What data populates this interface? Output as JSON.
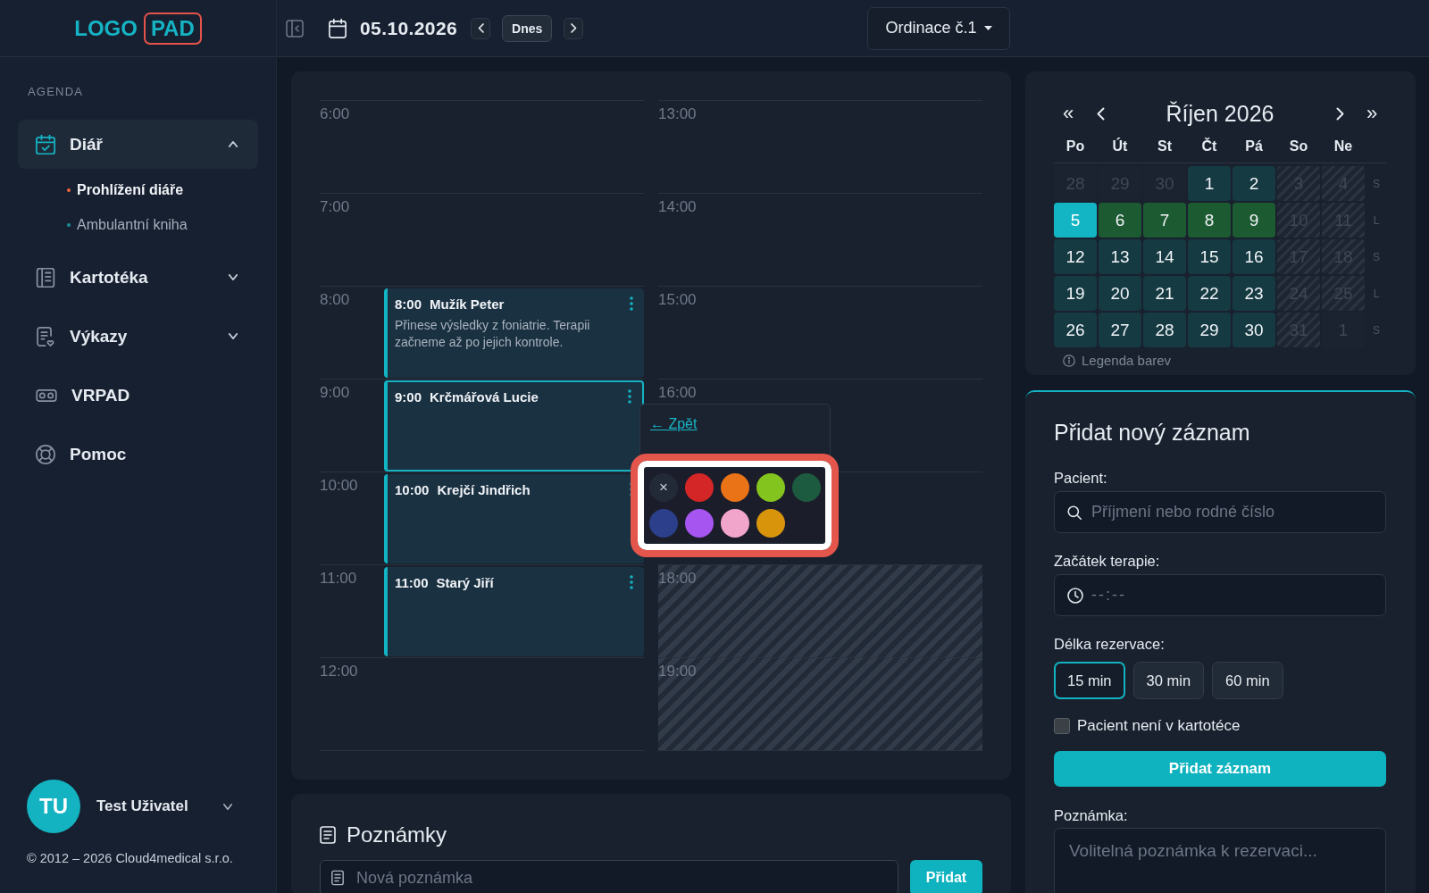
{
  "sidebar": {
    "logo_left": "LOGO",
    "logo_right": "PAD",
    "section": "AGENDA",
    "items": [
      {
        "label": "Diář",
        "kind": "group",
        "expanded": true,
        "selected": true,
        "children": [
          {
            "label": "Prohlížení diáře",
            "selected": true
          },
          {
            "label": "Ambulantní kniha",
            "selected": false
          }
        ]
      },
      {
        "label": "Kartotéka",
        "kind": "group",
        "expanded": false,
        "selected": false
      },
      {
        "label": "Výkazy",
        "kind": "group",
        "expanded": false,
        "selected": false
      },
      {
        "label": "VRPAD",
        "kind": "link",
        "selected": false
      },
      {
        "label": "Pomoc",
        "kind": "link",
        "selected": false
      }
    ],
    "user": {
      "initials": "TU",
      "name": "Test Uživatel"
    },
    "copyright": "© 2012 – 2026 Cloud4medical s.r.o."
  },
  "topbar": {
    "date": "05.10.2026",
    "today": "Dnes",
    "room": "Ordinace č.1"
  },
  "schedule": {
    "columns": [
      {
        "hours": [
          {
            "label": "6:00",
            "available": true
          },
          {
            "label": "7:00",
            "available": true
          },
          {
            "label": "8:00",
            "available": true,
            "event": {
              "time": "8:00",
              "name": "Mužík Peter",
              "note": "Přinese výsledky z foniatrie. Terapii začneme až po jejich kontrole.",
              "selected": false
            }
          },
          {
            "label": "9:00",
            "available": true,
            "event": {
              "time": "9:00",
              "name": "Krčmářová Lucie",
              "selected": true
            }
          },
          {
            "label": "10:00",
            "available": true,
            "event": {
              "time": "10:00",
              "name": "Krejčí Jindřich",
              "selected": false
            }
          },
          {
            "label": "11:00",
            "available": true,
            "event": {
              "time": "11:00",
              "name": "Starý Jiří",
              "selected": false
            }
          },
          {
            "label": "12:00",
            "available": true
          }
        ]
      },
      {
        "hours": [
          {
            "label": "13:00",
            "available": true
          },
          {
            "label": "14:00",
            "available": true
          },
          {
            "label": "15:00",
            "available": true
          },
          {
            "label": "16:00",
            "available": true
          },
          {
            "available": true
          },
          {
            "label": "18:00",
            "available": false
          },
          {
            "label": "19:00",
            "available": false
          }
        ]
      }
    ],
    "color_menu": {
      "back": "← Zpět",
      "options": [
        {
          "kind": "none",
          "label": "×"
        },
        {
          "kind": "swatch",
          "color": "#d42626"
        },
        {
          "kind": "swatch",
          "color": "#ea7317"
        },
        {
          "kind": "swatch",
          "color": "#84c41e"
        },
        {
          "kind": "swatch",
          "color": "#1c5b40"
        },
        {
          "kind": "swatch",
          "color": "#2b3f8a"
        },
        {
          "kind": "swatch",
          "color": "#a655f0"
        },
        {
          "kind": "swatch",
          "color": "#f2a5cb"
        },
        {
          "kind": "swatch",
          "color": "#d8950c"
        }
      ]
    }
  },
  "calendar": {
    "nav": {
      "prev_year": "«",
      "next_year": "»"
    },
    "title": "Říjen 2026",
    "weekdays": [
      "Po",
      "Út",
      "St",
      "Čt",
      "Pá",
      "So",
      "Ne"
    ],
    "weeks": [
      {
        "parity": "S",
        "days": [
          {
            "day": "28",
            "kind": "outside",
            "selected": false
          },
          {
            "day": "29",
            "kind": "outside",
            "selected": false
          },
          {
            "day": "30",
            "kind": "outside",
            "selected": false
          },
          {
            "day": "1",
            "kind": "open",
            "selected": false
          },
          {
            "day": "2",
            "kind": "open",
            "selected": false
          },
          {
            "day": "3",
            "kind": "weekend",
            "selected": false
          },
          {
            "day": "4",
            "kind": "weekend",
            "selected": false
          }
        ]
      },
      {
        "parity": "L",
        "days": [
          {
            "day": "5",
            "kind": "open",
            "selected": true
          },
          {
            "day": "6",
            "kind": "booked",
            "selected": false
          },
          {
            "day": "7",
            "kind": "booked",
            "selected": false
          },
          {
            "day": "8",
            "kind": "booked",
            "selected": false
          },
          {
            "day": "9",
            "kind": "booked",
            "selected": false
          },
          {
            "day": "10",
            "kind": "weekend",
            "selected": false
          },
          {
            "day": "11",
            "kind": "weekend",
            "selected": false
          }
        ]
      },
      {
        "parity": "S",
        "days": [
          {
            "day": "12",
            "kind": "open",
            "selected": false
          },
          {
            "day": "13",
            "kind": "open",
            "selected": false
          },
          {
            "day": "14",
            "kind": "open",
            "selected": false
          },
          {
            "day": "15",
            "kind": "open",
            "selected": false
          },
          {
            "day": "16",
            "kind": "open",
            "selected": false
          },
          {
            "day": "17",
            "kind": "weekend",
            "selected": false
          },
          {
            "day": "18",
            "kind": "weekend",
            "selected": false
          }
        ]
      },
      {
        "parity": "L",
        "days": [
          {
            "day": "19",
            "kind": "open",
            "selected": false
          },
          {
            "day": "20",
            "kind": "open",
            "selected": false
          },
          {
            "day": "21",
            "kind": "open",
            "selected": false
          },
          {
            "day": "22",
            "kind": "open",
            "selected": false
          },
          {
            "day": "23",
            "kind": "open",
            "selected": false
          },
          {
            "day": "24",
            "kind": "weekend",
            "selected": false
          },
          {
            "day": "25",
            "kind": "weekend",
            "selected": false
          }
        ]
      },
      {
        "parity": "S",
        "days": [
          {
            "day": "26",
            "kind": "open",
            "selected": false
          },
          {
            "day": "27",
            "kind": "open",
            "selected": false
          },
          {
            "day": "28",
            "kind": "open",
            "selected": false
          },
          {
            "day": "29",
            "kind": "open",
            "selected": false
          },
          {
            "day": "30",
            "kind": "open",
            "selected": false
          },
          {
            "day": "31",
            "kind": "weekend",
            "selected": false
          },
          {
            "day": "1",
            "kind": "outside",
            "selected": false
          }
        ]
      }
    ],
    "legend": "Legenda barev"
  },
  "form": {
    "title": "Přidat nový záznam",
    "patient": {
      "label": "Pacient:",
      "placeholder": "Příjmení nebo rodné číslo"
    },
    "start": {
      "label": "Začátek terapie:",
      "placeholder": "--:--"
    },
    "duration": {
      "label": "Délka rezervace:",
      "options": [
        {
          "label": "15 min",
          "selected": true
        },
        {
          "label": "30 min",
          "selected": false
        },
        {
          "label": "60 min",
          "selected": false
        }
      ]
    },
    "not_in_registry": {
      "label": "Pacient není v kartotéce",
      "checked": false
    },
    "submit": "Přidat záznam",
    "note": {
      "label": "Poznámka:",
      "placeholder": "Volitelná poznámka k rezervaci..."
    }
  },
  "notes": {
    "title": "Poznámky",
    "placeholder": "Nová poznámka",
    "add": "Přidat"
  }
}
